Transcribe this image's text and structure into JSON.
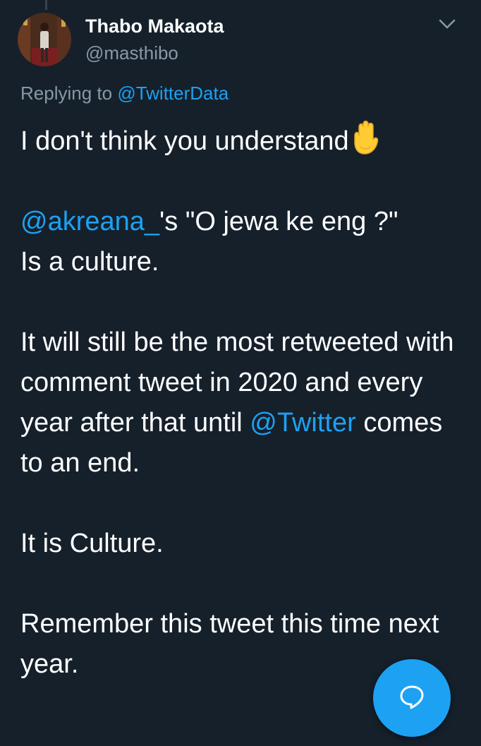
{
  "tweet": {
    "author": {
      "display_name": "Thabo Makaota",
      "handle": "@masthibo"
    },
    "replying_prefix": "Replying to",
    "replying_handle": "@TwitterData",
    "paragraphs": {
      "p1": "I don't think you understand",
      "p2_mention": "@akreana_",
      "p2_text_line1": "'s \"O jewa ke eng ?\"",
      "p2_text_line2": "Is a culture.",
      "p3_before": "It will still be the most retweeted with comment tweet in 2020 and every year after that until",
      "p3_mention": "@Twitter",
      "p3_after": "comes to an end.",
      "p4": "It is Culture.",
      "p5": "Remember this tweet this time next year."
    }
  },
  "icons": {
    "menu": "chevron-down-icon",
    "emoji": "raised-hand-emoji",
    "fab": "reply-bubble-icon"
  },
  "colors": {
    "background": "#15202b",
    "link": "#1da1f2",
    "muted": "#8899a6",
    "text": "#ffffff"
  }
}
